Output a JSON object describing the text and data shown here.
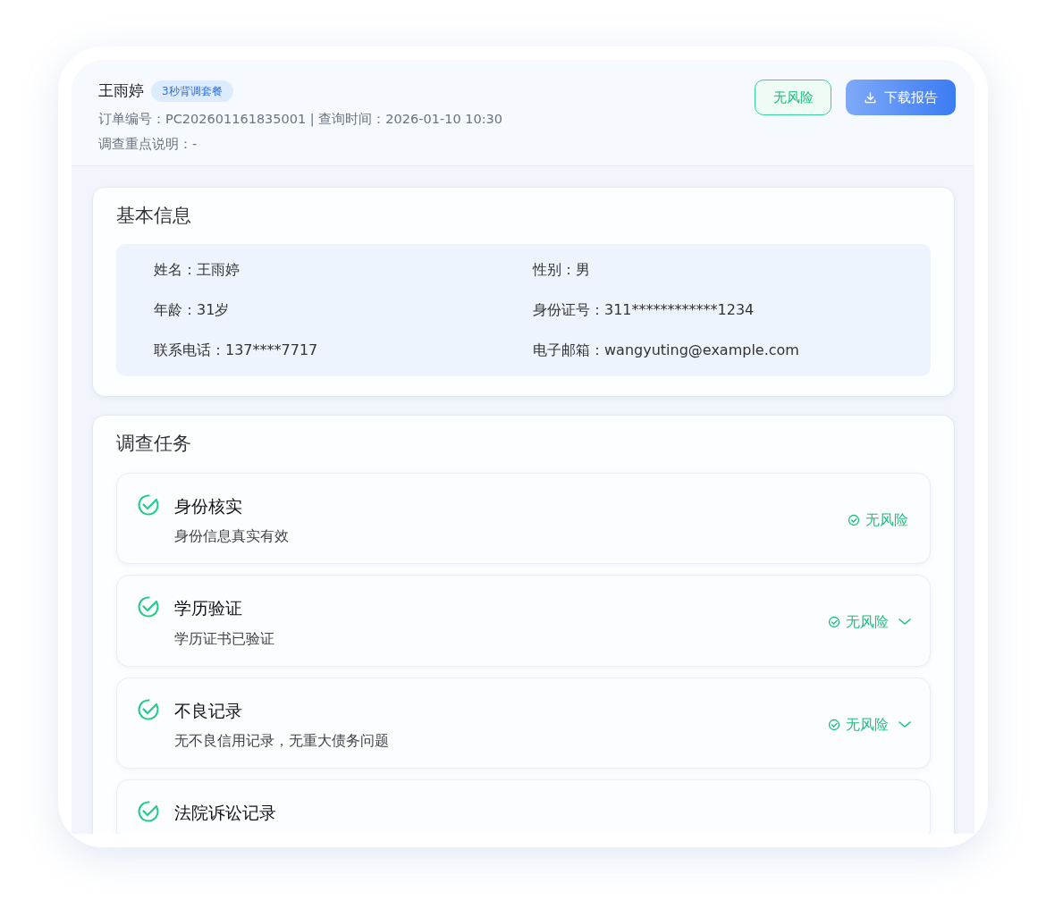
{
  "header": {
    "name": "王雨婷",
    "package_badge": "3秒背调套餐",
    "order_line": "订单编号：PC202601161835001 | 查询时间：2026-01-10 10:30",
    "focus_note": "调查重点说明：-",
    "risk_button": "无风险",
    "download_button": "下载报告"
  },
  "basic_info": {
    "title": "基本信息",
    "fields": [
      {
        "label": "姓名：",
        "value": "王雨婷"
      },
      {
        "label": "性别：",
        "value": "男"
      },
      {
        "label": "年龄：",
        "value": "31岁"
      },
      {
        "label": "身份证号：",
        "value": "311************1234"
      },
      {
        "label": "联系电话：",
        "value": "137****7717"
      },
      {
        "label": "电子邮箱：",
        "value": "wangyuting@example.com"
      }
    ]
  },
  "tasks": {
    "title": "调查任务",
    "items": [
      {
        "name": "身份核实",
        "detail": "身份信息真实有效",
        "status": "无风险",
        "done": true,
        "expandable": false
      },
      {
        "name": "学历验证",
        "detail": "学历证书已验证",
        "status": "无风险",
        "done": true,
        "expandable": true
      },
      {
        "name": "不良记录",
        "detail": "无不良信用记录，无重大债务问题",
        "status": "无风险",
        "done": true,
        "expandable": true
      },
      {
        "name": "法院诉讼记录",
        "done": true,
        "expandable": false
      }
    ]
  }
}
